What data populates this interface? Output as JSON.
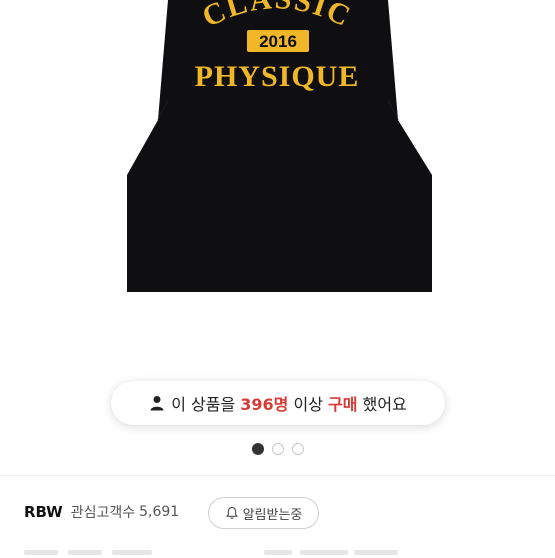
{
  "product_image": {
    "print_line1": "CLASSIC",
    "print_year": "2016",
    "print_line2": "PHYSIQUE",
    "colors": {
      "shirt": "#0f0f12",
      "print": "#f0b829"
    }
  },
  "purchase_banner": {
    "prefix": "이 상품을",
    "count": "396명",
    "middle": "이상",
    "action": "구매",
    "suffix": "했어요",
    "icon": "person-icon",
    "highlight_color": "#d83a34"
  },
  "carousel": {
    "total": 3,
    "active_index": 0
  },
  "store": {
    "name": "RBW",
    "favorites_label": "관심고객수",
    "favorites_count": "5,691",
    "notify_button_label": "알림받는중",
    "notify_icon": "bell-icon"
  }
}
